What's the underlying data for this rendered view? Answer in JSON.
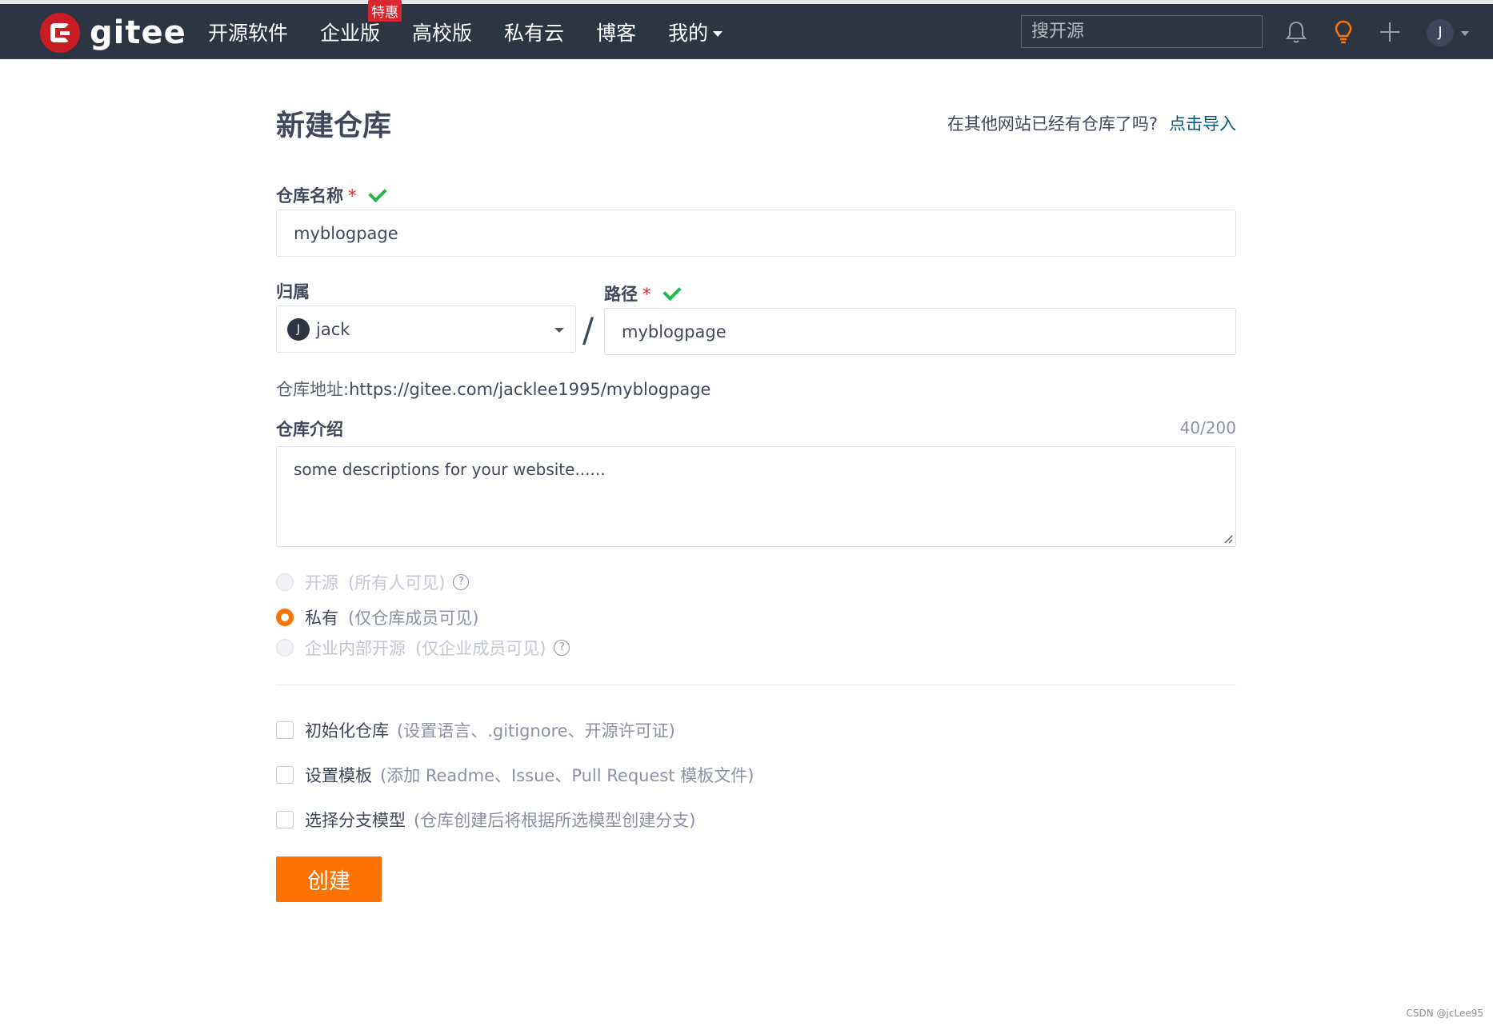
{
  "nav": {
    "logo_text": "gitee",
    "items": [
      {
        "label": "开源软件"
      },
      {
        "label": "企业版",
        "badge": "特惠"
      },
      {
        "label": "高校版"
      },
      {
        "label": "私有云"
      },
      {
        "label": "博客"
      },
      {
        "label": "我的"
      }
    ],
    "search_placeholder": "搜开源",
    "avatar_initial": "J",
    "icons": [
      "bell-icon",
      "lightbulb-icon",
      "plus-icon"
    ]
  },
  "form": {
    "title": "新建仓库",
    "import_prompt": "在其他网站已经有仓库了吗?",
    "import_link": "点击导入",
    "repo_name_label": "仓库名称",
    "required_mark": "*",
    "repo_name_value": "myblogpage",
    "owner_label": "归属",
    "owner_avatar": "J",
    "owner_value": "jack",
    "slash": "/",
    "path_label": "路径",
    "path_value": "myblogpage",
    "address_prefix": "仓库地址:",
    "address_value": "https://gitee.com/jacklee1995/myblogpage",
    "desc_label": "仓库介绍",
    "desc_counter": "40/200",
    "desc_value": "some descriptions for your website......",
    "visibility": [
      {
        "label": "开源",
        "note": "(所有人可见)",
        "help": "?",
        "selected": false,
        "disabled": true
      },
      {
        "label": "私有",
        "note": "(仅仓库成员可见)",
        "selected": true,
        "disabled": false
      },
      {
        "label": "企业内部开源",
        "note": "(仅企业成员可见)",
        "help": "?",
        "selected": false,
        "disabled": true
      }
    ],
    "options": [
      {
        "label": "初始化仓库",
        "note": "(设置语言、.gitignore、开源许可证)",
        "checked": false
      },
      {
        "label": "设置模板",
        "note": "(添加 Readme、Issue、Pull Request 模板文件)",
        "checked": false
      },
      {
        "label": "选择分支模型",
        "note": "(仓库创建后将根据所选模型创建分支)",
        "checked": false
      }
    ],
    "submit_label": "创建"
  },
  "watermark": "CSDN @jcLee95",
  "colors": {
    "nav_bg": "#2e3542",
    "brand_red": "#c71d23",
    "accent_orange": "#fe7300",
    "check_green": "#21ba45",
    "link_blue": "#005980"
  }
}
